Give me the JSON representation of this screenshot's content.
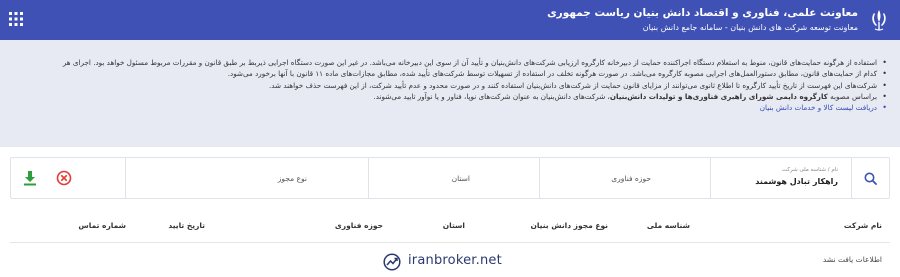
{
  "header": {
    "title": "معاونت علمی، فناوری و اقتصاد دانش بنیان ریاست جمهوری",
    "subtitle": "معاونت توسعه شرکت های دانش بنیان - سامانه جامع دانش بنیان",
    "emblem_icon": "iran-emblem-icon",
    "menu_icon": "grid-menu-icon",
    "bg_color": "#3f51b5"
  },
  "notice": {
    "bg_color": "#e7eaf3",
    "items": [
      "استفاده از هرگونه حمایت‌های قانون، منوط به استعلام دستگاه اجراکننده حمایت از دبیرخانه کارگروه ارزیابی شرکت‌های دانش‌بنیان و تأیید آن از سوی این دبیرخانه می‌باشد. در غیر این صورت دستگاه اجرایی ذیربط بر طبق قانون و مقررات مربوط مسئول خواهد بود. اجرای هر",
      "کدام از حمایت‌های قانون، مطابق دستورالعمل‌های اجرایی مصوبه کارگروه می‌باشد. در صورت هرگونه تخلف در استفاده از تسهیلات توسط شرکت‌های تأیید شده، مطابق مجازات‌های ماده ۱۱ قانون با آنها برخورد می‌شود.",
      "شرکت‌های این فهرست از تاریخ تأیید کارگروه تا اطلاع ثانوی می‌توانند از مزایای قانون حمایت از شرکت‌های دانش‌بنیان استفاده کنند و در صورت محدود و عدم تأیید شرکت، از این فهرست حذف خواهند شد.",
      {
        "pre": "براساس مصوبه ",
        "bold": "کارگروه دایمی شورای راهبری فناوری‌ها و تولیدات دانش‌بنیان",
        "post": "، شرکت‌های دانش‌بنیان به عنوان شرکت‌های نوپا، فناور و یا نوآور تایید می‌شوند."
      },
      "دریافت لیست کالا و خدمات دانش بنیان"
    ]
  },
  "filters": {
    "search_icon": "search-icon",
    "name_field_label": "نام / شناسه ملی شرکت",
    "name_field_value": "راهکار تبادل هوشمند",
    "tech_area_placeholder": "حوزه فناوری",
    "province_placeholder": "استان",
    "permit_type_placeholder": "نوع مجوز",
    "clear_icon": "clear-filter-icon",
    "download_icon": "download-icon"
  },
  "table": {
    "columns": [
      "نام شرکت",
      "شناسه ملی",
      "نوع مجوز دانش بنیان",
      "استان",
      "حوزه فناوری",
      "تاریخ تایید",
      "شماره تماس"
    ],
    "empty_message": "اطلاعات یافت نشد"
  },
  "watermark": {
    "text": "iranbroker.net",
    "icon": "iranbroker-logo-icon"
  }
}
